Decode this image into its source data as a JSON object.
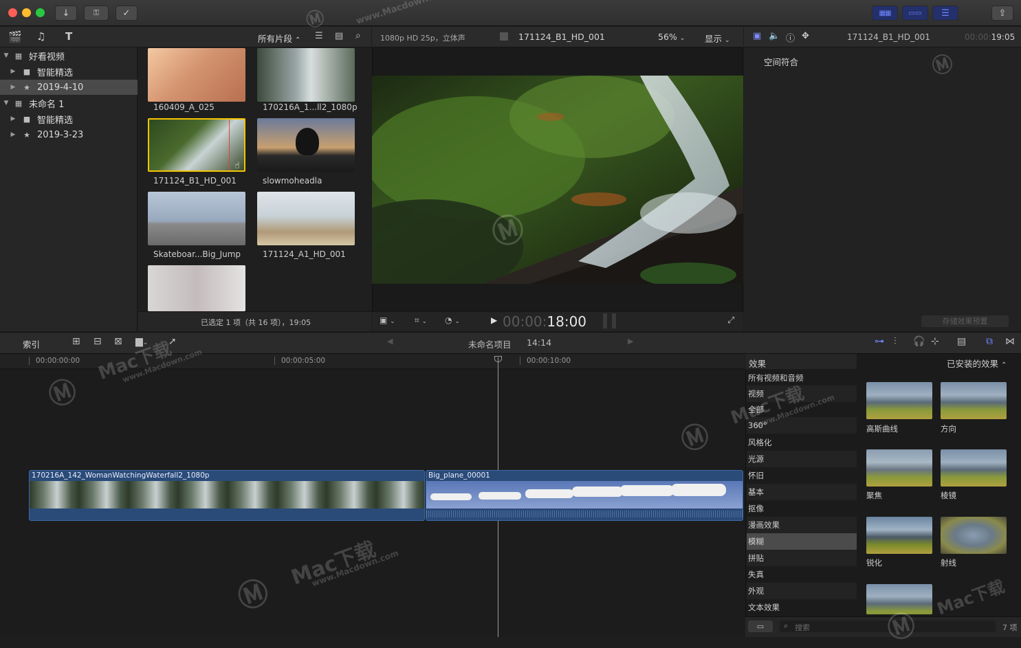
{
  "titlebar": {
    "traffic_colors": [
      "#fe5f57",
      "#febc2e",
      "#28c840"
    ],
    "tool_icons": [
      "download-icon",
      "key-icon",
      "checkmark-circle-icon"
    ],
    "workspace_icons": [
      "grid-view-icon",
      "filmstrip-view-icon",
      "sliders-icon"
    ],
    "share_icon": "share-icon"
  },
  "library": {
    "toolbar_icons": [
      "libraries-icon",
      "photos-audio-icon",
      "titles-generators-icon"
    ],
    "items": [
      {
        "label": "好看视频",
        "level": 0,
        "icon": "library-icon",
        "expanded": true
      },
      {
        "label": "智能精选",
        "level": 1,
        "icon": "folder-icon",
        "expanded": false
      },
      {
        "label": "2019-4-10",
        "level": 1,
        "icon": "event-icon",
        "expanded": false,
        "selected": true
      },
      {
        "label": "未命名 1",
        "level": 0,
        "icon": "library-icon",
        "expanded": true
      },
      {
        "label": "智能精选",
        "level": 1,
        "icon": "folder-icon",
        "expanded": false
      },
      {
        "label": "2019-3-23",
        "level": 1,
        "icon": "event-icon",
        "expanded": false
      }
    ]
  },
  "browser": {
    "filter_label": "所有片段",
    "clips": [
      {
        "name": "160409_A_025",
        "color": "#c99a7a"
      },
      {
        "name": "170216A_1...ll2_1080p",
        "color": "#6a7a7a"
      },
      {
        "name": "171124_B1_HD_001",
        "color": "#3e5a2e",
        "selected": true
      },
      {
        "name": "slowmoheadla",
        "color": "#3a4a5a"
      },
      {
        "name": "Skateboar...Big_Jump",
        "color": "#9aa8b8"
      },
      {
        "name": "171124_A1_HD_001",
        "color": "#b8c0c8"
      },
      {
        "name": "",
        "color": "#c8c4c4"
      }
    ],
    "status": "已选定 1 项（共 16 项），19:05"
  },
  "viewer": {
    "format": "1080p HD 25p，立体声",
    "clip_name": "171124_B1_HD_001",
    "zoom": "56%",
    "display_label": "显示",
    "timecode_dim": "00:00:",
    "timecode_main": "18:00"
  },
  "inspector": {
    "clip_name": "171124_B1_HD_001",
    "timecode_dim": "00:00:",
    "timecode_main": "19:05",
    "section": "空间符合",
    "save_button": "存储效果预置"
  },
  "timeline": {
    "index_label": "索引",
    "project_name": "未命名项目",
    "project_duration": "14:14",
    "ruler": [
      "00:00:00:00",
      "00:00:05:00",
      "00:00:10:00"
    ],
    "clips": [
      {
        "name": "170216A_142_WomanWatchingWaterfall2_1080p"
      },
      {
        "name": "Big_plane_00001"
      }
    ]
  },
  "effects": {
    "title": "效果",
    "installed_label": "已安装的效果",
    "categories": [
      "所有视频和音频",
      "视频",
      "全部",
      "360°",
      "风格化",
      "光源",
      "怀旧",
      "基本",
      "抠像",
      "漫画效果",
      "模糊",
      "拼贴",
      "失真",
      "外观",
      "文本效果"
    ],
    "selected_category": "模糊",
    "items": [
      "高斯曲线",
      "方向",
      "聚焦",
      "棱镜",
      "锐化",
      "射线",
      ""
    ],
    "search_placeholder": "搜索",
    "count": "7 项"
  },
  "watermarks": [
    "Mac下载",
    "www.Macdown.com"
  ]
}
